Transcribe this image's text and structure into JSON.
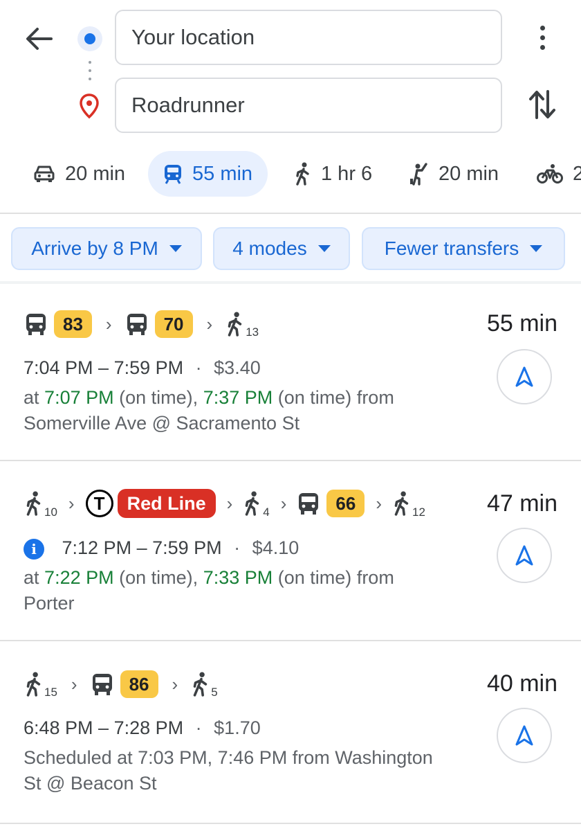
{
  "search": {
    "origin": "Your location",
    "destination": "Roadrunner"
  },
  "modes": [
    {
      "icon": "car-icon",
      "label": "20 min"
    },
    {
      "icon": "transit-icon",
      "label": "55 min",
      "selected": true
    },
    {
      "icon": "walk-icon",
      "label": "1 hr 6"
    },
    {
      "icon": "ride-hail-icon",
      "label": "20 min"
    },
    {
      "icon": "bike-icon",
      "label": "2"
    }
  ],
  "filters": [
    "Arrive by 8 PM",
    "4 modes",
    "Fewer transfers"
  ],
  "routes": [
    {
      "duration": "55 min",
      "steps": [
        {
          "type": "bus",
          "label": "83"
        },
        {
          "type": "bus",
          "label": "70"
        },
        {
          "type": "walk",
          "minutes": "13"
        }
      ],
      "times": "7:04 PM – 7:59 PM",
      "fare": "$3.40",
      "dep1": "7:07 PM",
      "status1": "(on time)",
      "dep2": "7:37 PM",
      "status2": "(on time)",
      "from_prefix": "at",
      "from_word": "from",
      "stop": "Somerville Ave @ Sacramento St"
    },
    {
      "duration": "47 min",
      "steps": [
        {
          "type": "walk",
          "minutes": "10"
        },
        {
          "type": "subway",
          "logo": "T",
          "label": "Red Line"
        },
        {
          "type": "walk",
          "minutes": "4"
        },
        {
          "type": "bus",
          "label": "66"
        },
        {
          "type": "walk",
          "minutes": "12"
        }
      ],
      "times": "7:12 PM – 7:59 PM",
      "fare": "$4.10",
      "dep1": "7:22 PM",
      "status1": "(on time)",
      "dep2": "7:33 PM",
      "status2": "(on time)",
      "from_prefix": "at",
      "from_word": "from",
      "stop": "Porter",
      "info_icon": "info-icon"
    },
    {
      "duration": "40 min",
      "steps": [
        {
          "type": "walk",
          "minutes": "15"
        },
        {
          "type": "bus",
          "label": "86"
        },
        {
          "type": "walk",
          "minutes": "5"
        }
      ],
      "times": "6:48 PM – 7:28 PM",
      "fare": "$1.70",
      "schedule_line1": "Scheduled at 7:03 PM, 7:46 PM from Washington",
      "schedule_line2": "St @ Beacon St"
    }
  ],
  "separator": "·",
  "colors": {
    "accent": "#1a73e8",
    "on_time": "#188038",
    "bus_badge": "#f9c846",
    "red_line": "#d93025"
  }
}
